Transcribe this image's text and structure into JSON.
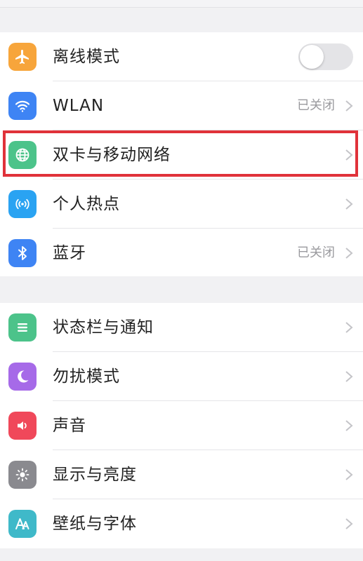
{
  "group1": {
    "airplane": {
      "label": "离线模式",
      "icon": "airplane-icon",
      "color": "#f7a53b",
      "toggle_on": false
    },
    "wlan": {
      "label": "WLAN",
      "icon": "wifi-icon",
      "color": "#3e84f4",
      "status": "已关闭"
    },
    "dual_sim": {
      "label": "双卡与移动网络",
      "icon": "globe-icon",
      "color": "#4cc38a"
    },
    "hotspot": {
      "label": "个人热点",
      "icon": "hotspot-icon",
      "color": "#2aa3f2"
    },
    "bluetooth": {
      "label": "蓝牙",
      "icon": "bluetooth-icon",
      "color": "#3e84f4",
      "status": "已关闭"
    }
  },
  "group2": {
    "statusbar": {
      "label": "状态栏与通知",
      "icon": "list-icon",
      "color": "#4cc38a"
    },
    "dnd": {
      "label": "勿扰模式",
      "icon": "moon-icon",
      "color": "#a66ae8"
    },
    "sound": {
      "label": "声音",
      "icon": "speaker-icon",
      "color": "#f0485a"
    },
    "display": {
      "label": "显示与亮度",
      "icon": "sun-icon",
      "color": "#8a8a8f"
    },
    "wallpaper": {
      "label": "壁纸与字体",
      "icon": "font-icon",
      "color": "#3fb9c9"
    }
  },
  "highlight_color": "#e0323a"
}
